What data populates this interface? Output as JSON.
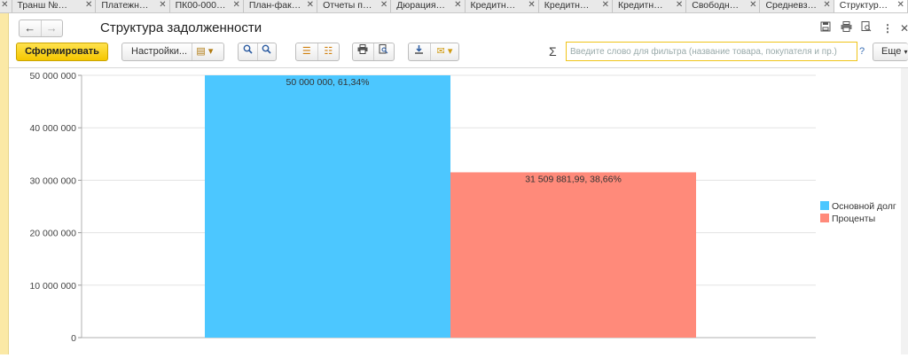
{
  "tabs": [
    {
      "label": "Транш №…"
    },
    {
      "label": "Платежн…"
    },
    {
      "label": "ПК00-000…"
    },
    {
      "label": "План-фак…"
    },
    {
      "label": "Отчеты п…"
    },
    {
      "label": "Дюрация…"
    },
    {
      "label": "Кредитн…"
    },
    {
      "label": "Кредитн…"
    },
    {
      "label": "Кредитн…"
    },
    {
      "label": "Свободн…"
    },
    {
      "label": "Средневз…"
    },
    {
      "label": "Структур…",
      "active": true
    }
  ],
  "header": {
    "back_icon": "←",
    "forward_icon": "→",
    "title": "Структура задолженности",
    "icons": [
      "save-icon",
      "print-icon",
      "search-doc-icon",
      "more-icon",
      "close-icon"
    ]
  },
  "toolbar": {
    "generate_label": "Сформировать",
    "settings_label": "Настройки...",
    "filter_placeholder": "Введите слово для фильтра (название товара, покупателя и пр.)",
    "filter_value": "",
    "help_label": "?",
    "more_label": "Еще",
    "sigma_label": "Σ"
  },
  "chart_data": {
    "type": "bar",
    "categories": [
      "Основной долг",
      "Проценты"
    ],
    "values": [
      50000000,
      31509881.99
    ],
    "data_labels": [
      "50 000 000, 61,34%",
      "31 509 881,99, 38,66%"
    ],
    "colors": [
      "#4cc7ff",
      "#ff8a7a"
    ],
    "ylim": [
      0,
      50000000
    ],
    "yticks": [
      0,
      10000000,
      20000000,
      30000000,
      40000000,
      50000000
    ],
    "ytick_labels": [
      "0",
      "10 000 000",
      "20 000 000",
      "30 000 000",
      "40 000 000",
      "50 000 000"
    ],
    "legend": [
      "Основной долг",
      "Проценты"
    ],
    "legend_position": "right",
    "grid": true
  }
}
